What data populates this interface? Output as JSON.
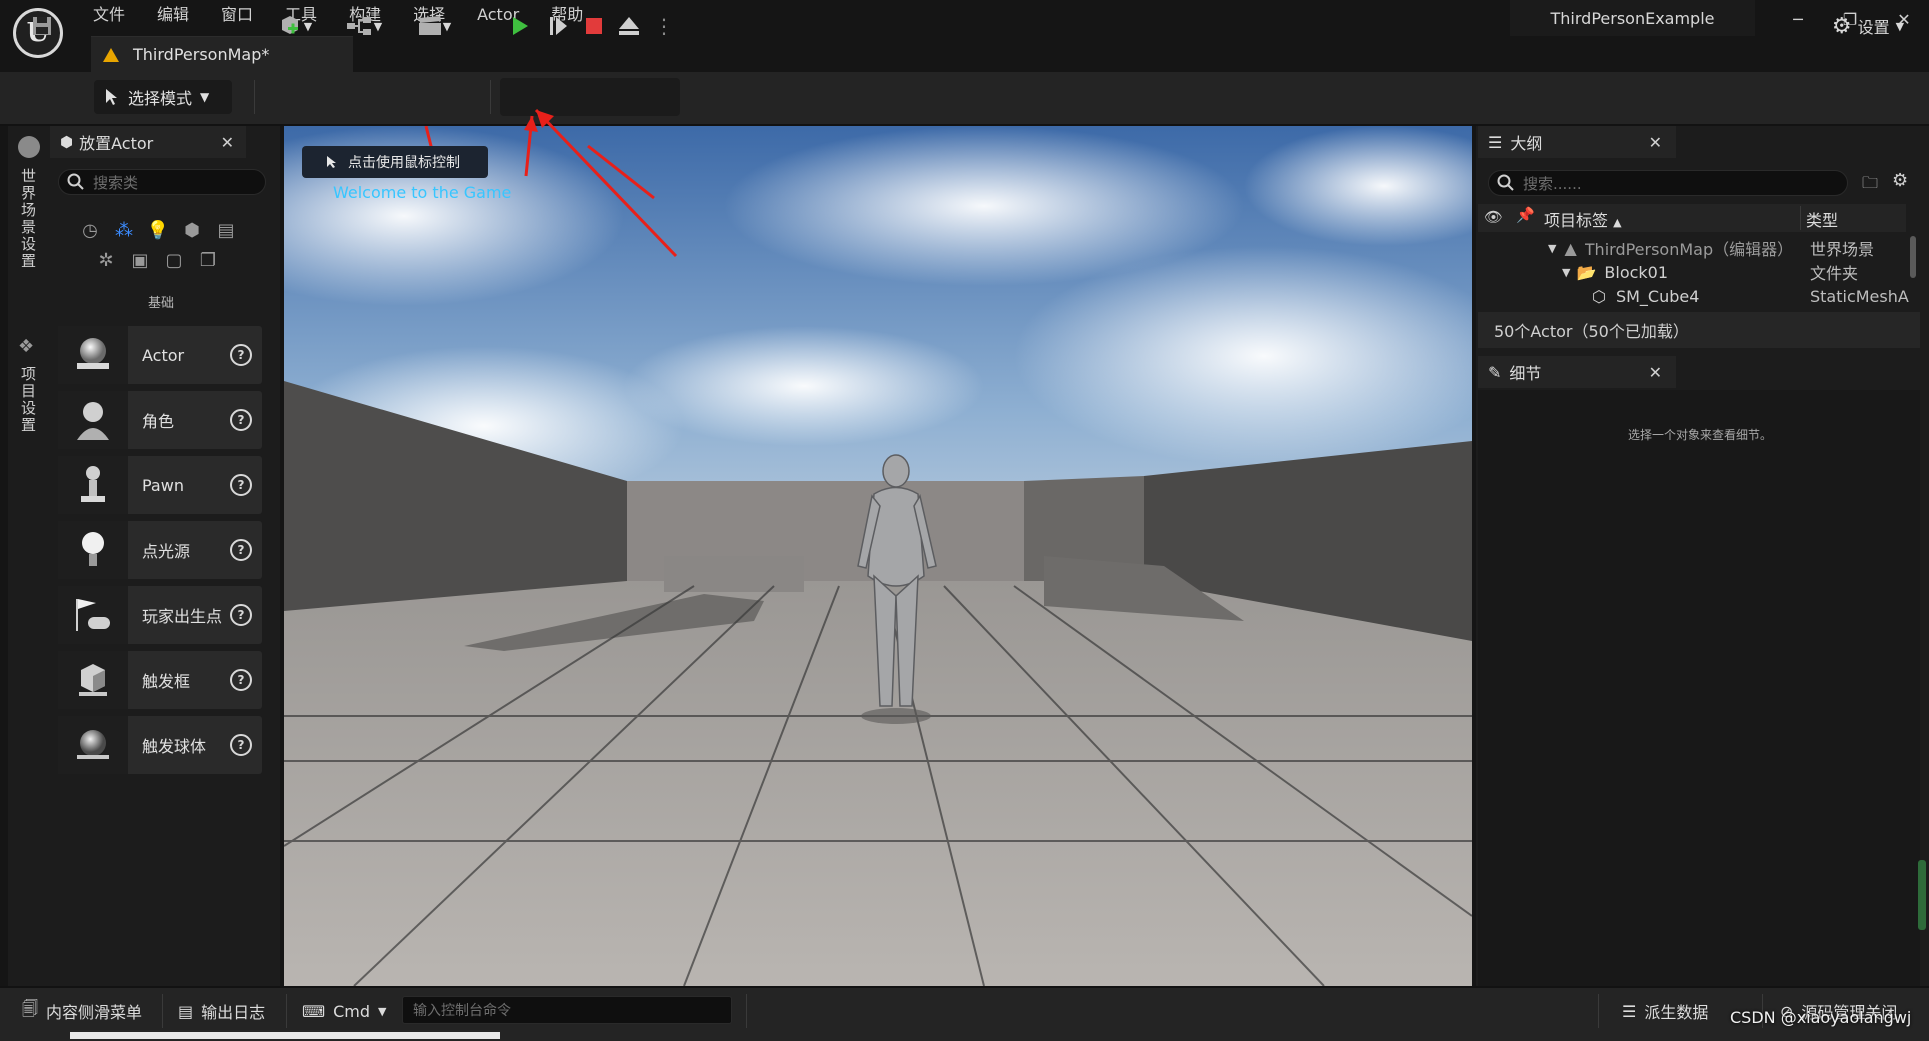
{
  "app": {
    "project_name": "ThirdPersonExample",
    "map_tab": "ThirdPersonMap*",
    "menu": [
      "文件",
      "编辑",
      "窗口",
      "工具",
      "构建",
      "选择",
      "Actor",
      "帮助"
    ]
  },
  "toolbar": {
    "mode_label": "选择模式",
    "settings_label": "设置"
  },
  "left_strip": {
    "world_settings": "世界场景设置",
    "project_settings": "项目设置"
  },
  "place_actor": {
    "title": "放置Actor",
    "search_placeholder": "搜索类",
    "category_label": "基础",
    "items": [
      {
        "label": "Actor"
      },
      {
        "label": "角色"
      },
      {
        "label": "Pawn"
      },
      {
        "label": "点光源"
      },
      {
        "label": "玩家出生点"
      },
      {
        "label": "触发框"
      },
      {
        "label": "触发球体"
      }
    ]
  },
  "viewport": {
    "mouse_hint": "点击使用鼠标控制",
    "welcome": "Welcome to the Game"
  },
  "outliner": {
    "title": "大纲",
    "search_placeholder": "搜索......",
    "col_label": "项目标签",
    "col_type": "类型",
    "rows": [
      {
        "label": "ThirdPersonMap（编辑器）",
        "type": "世界场景"
      },
      {
        "label": "Block01",
        "type": "文件夹"
      },
      {
        "label": "SM_Cube4",
        "type": "StaticMeshA"
      }
    ],
    "footer": "50个Actor（50个已加载）"
  },
  "details": {
    "title": "细节",
    "empty_hint": "选择一个对象来查看细节。"
  },
  "bottom": {
    "content_drawer": "内容侧滑菜单",
    "output_log": "输出日志",
    "cmd": "Cmd",
    "console_placeholder": "输入控制台命令",
    "derived_data": "派生数据",
    "source_control": "源码管理关闭",
    "watermark": "CSDN @xiaoyaolangwj"
  },
  "colors": {
    "play_green": "#3fbf3f",
    "stop_red": "#e23b3b",
    "welcome_cyan": "#37c6ff",
    "annotation_red": "#e8201a"
  }
}
